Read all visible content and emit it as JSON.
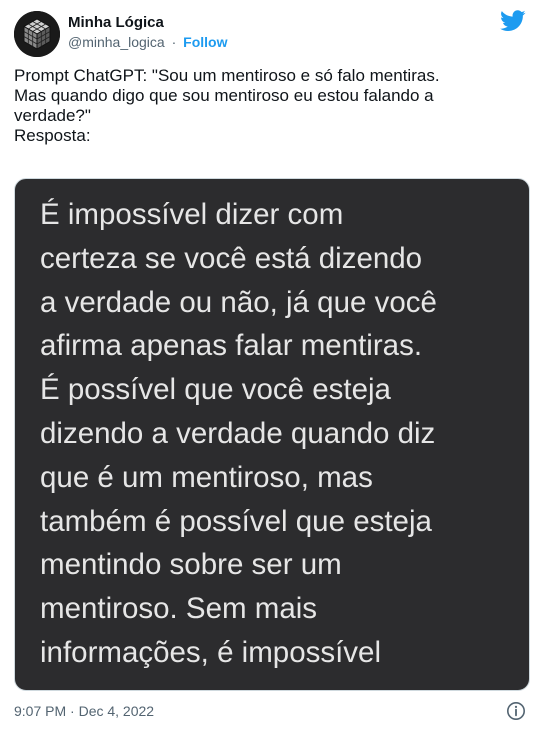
{
  "author": {
    "name": "Minha Lógica",
    "handle": "@minha_logica",
    "separator": "·",
    "follow_label": "Follow",
    "avatar_icon": "rubiks-cube-avatar",
    "brand_icon": "twitter-bird-icon"
  },
  "tweet": {
    "lines": [
      "Prompt ChatGPT: \"Sou um mentiroso e só falo mentiras.",
      "Mas quando digo que sou mentiroso eu estou falando a",
      "verdade?\"",
      "Resposta:"
    ]
  },
  "media": {
    "lines": [
      "É impossível dizer com",
      "certeza se você está dizendo",
      "a verdade ou não, já que você",
      "afirma apenas falar mentiras.",
      "É possível que você esteja",
      "dizendo a verdade quando diz",
      "que é um mentiroso, mas",
      "também é possível que esteja",
      "mentindo sobre ser um",
      "mentiroso. Sem mais",
      "informações, é impossível"
    ]
  },
  "footer": {
    "timestamp": "9:07 PM · Dec 4, 2022",
    "info_icon": "info-icon"
  },
  "colors": {
    "accent": "#1d9bf0",
    "text": "#0f1419",
    "muted": "#536471",
    "media_bg": "#2c2c2e",
    "media_text": "#e6e6e6"
  }
}
